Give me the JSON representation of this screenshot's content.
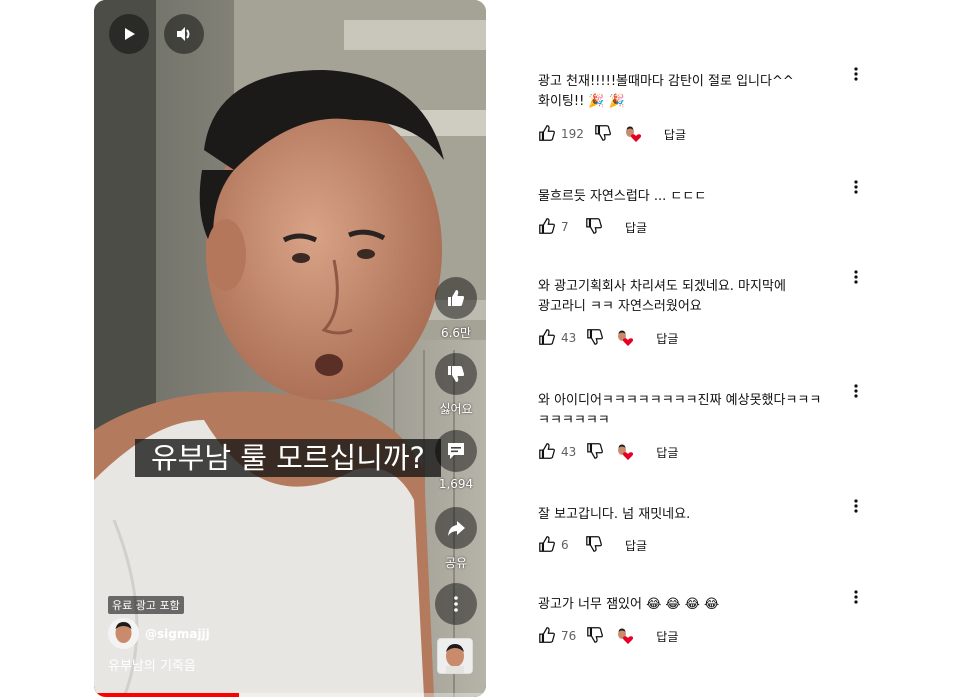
{
  "player": {
    "caption": "유부남 룰 모르십니까?",
    "like_count": "6.6만",
    "dislike_label": "싫어요",
    "comment_count": "1,694",
    "share_label": "공유",
    "paid_promotion": "유료 광고 포함",
    "channel_handle": "@sigmajjj",
    "title": "유부남의 기죽음",
    "progress_fraction": 0.37
  },
  "comments": [
    {
      "text": "광고 천재!!!!!볼때마다 감탄이 절로 입니다^^ 화이팅!! 🎉 🎉",
      "likes": "192",
      "hearted": true,
      "reply": "답글"
    },
    {
      "text": "물흐르듯 자연스럽다 ... ㄷㄷㄷ",
      "likes": "7",
      "hearted": false,
      "reply": "답글"
    },
    {
      "text": "와 광고기획회사 차리셔도 되겠네요. 마지막에 광고라니 ㅋㅋ 자연스러웠어요",
      "likes": "43",
      "hearted": true,
      "reply": "답글"
    },
    {
      "text": "와 아이디어ㅋㅋㅋㅋㅋㅋㅋㅋ진짜 예상못했다ㅋㅋㅋㅋㅋㅋㅋㅋㅋ",
      "likes": "43",
      "hearted": true,
      "reply": "답글"
    },
    {
      "text": "잘 보고갑니다. 넘 재밋네요.",
      "likes": "6",
      "hearted": false,
      "reply": "답글"
    },
    {
      "text": "광고가 너무 잼있어 😂 😂 😂 😂",
      "likes": "76",
      "hearted": true,
      "reply": "답글"
    }
  ],
  "colors": {
    "progress": "#ff0000",
    "heart": "#e60023",
    "text": "#0f0f0f",
    "muted": "#606060"
  }
}
